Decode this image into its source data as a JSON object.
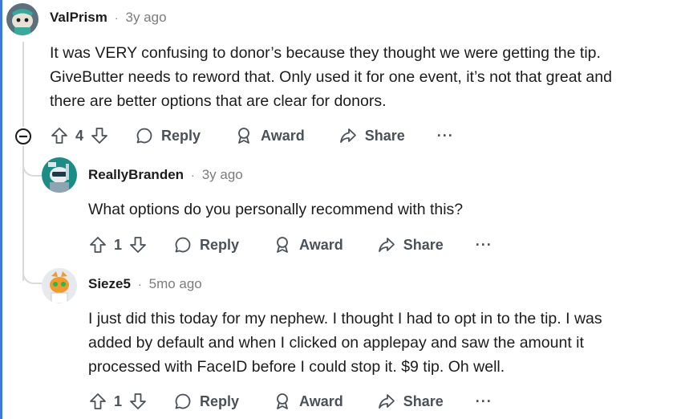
{
  "colors": {
    "accent": "#3b7ad9",
    "text": "#1c1c1c",
    "muted": "#7c7c7c",
    "action": "#4a5158"
  },
  "comments": [
    {
      "username": "ValPrism",
      "separator": "·",
      "time": "3y ago",
      "body": "It was VERY confusing to donor’s because they thought we were getting the tip.\nGiveButter needs to reword that. Only used it for one event, it’s not that great and\nthere are better options that are clear for donors.",
      "votes": "4",
      "reply_label": "Reply",
      "award_label": "Award",
      "share_label": "Share",
      "more_label": "···"
    },
    {
      "username": "ReallyBranden",
      "separator": "·",
      "time": "3y ago",
      "body": "What options do you personally recommend with this?",
      "votes": "1",
      "reply_label": "Reply",
      "award_label": "Award",
      "share_label": "Share",
      "more_label": "···"
    },
    {
      "username": "Sieze5",
      "separator": "·",
      "time": "5mo ago",
      "body": "I just did this today for my nephew. I thought I had to opt in to the tip. I was\nadded by default and when I clicked on applepay and saw the amount it\nprocessed with FaceID before I could stop it. $9 tip. Oh well.",
      "votes": "1",
      "reply_label": "Reply",
      "award_label": "Award",
      "share_label": "Share",
      "more_label": "···"
    }
  ]
}
